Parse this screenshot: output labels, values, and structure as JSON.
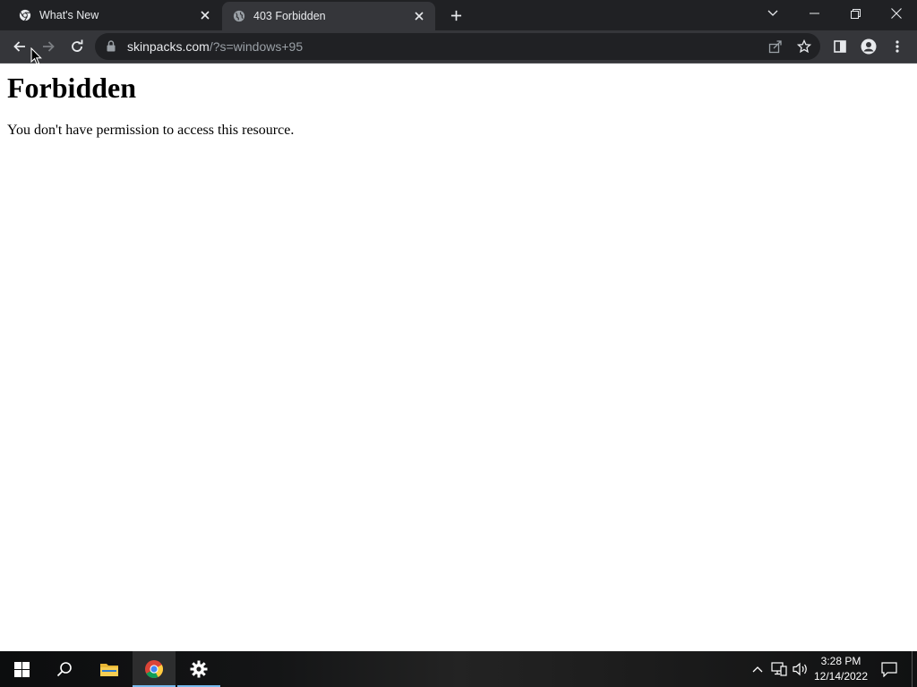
{
  "browser": {
    "tabs": [
      {
        "title": "What's New",
        "icon": "chrome-logo-icon",
        "active": false
      },
      {
        "title": "403 Forbidden",
        "icon": "globe-icon",
        "active": true
      }
    ],
    "address": {
      "domain": "skinpacks.com",
      "path": "/?s=windows+95"
    }
  },
  "page": {
    "heading": "Forbidden",
    "message": "You don't have permission to access this resource."
  },
  "taskbar": {
    "time": "3:28 PM",
    "date": "12/14/2022",
    "pinned": [
      "start-icon",
      "search-icon",
      "file-explorer-icon",
      "chrome-icon",
      "settings-icon"
    ]
  },
  "colors": {
    "tabstrip": "#202124",
    "toolbar": "#35363a",
    "omnibox": "#202124",
    "accent_underline": "#76b9ed"
  }
}
